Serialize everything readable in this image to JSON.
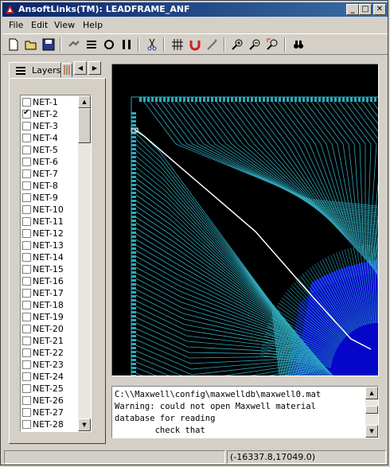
{
  "window": {
    "title": "AnsoftLinks(TM): LEADFRAME_ANF",
    "minimize": "_",
    "maximize": "□",
    "close": "✕"
  },
  "menu": {
    "items": [
      "File",
      "Edit",
      "View",
      "Help"
    ]
  },
  "toolbar": {
    "icons": [
      "new-icon",
      "open-icon",
      "save-icon",
      "line-icon",
      "layers-icon",
      "circle-icon",
      "columns-icon",
      "cut-icon",
      "grid-icon",
      "magnet-icon",
      "wand-icon",
      "zoom-in-icon",
      "zoom-out-icon",
      "zoom-fit-icon",
      "binoculars-icon"
    ]
  },
  "tabs": {
    "active": "Layers",
    "prev": "◀",
    "next": "▶"
  },
  "nets": [
    {
      "label": "NET-1",
      "checked": false
    },
    {
      "label": "NET-2",
      "checked": true
    },
    {
      "label": "NET-3",
      "checked": false
    },
    {
      "label": "NET-4",
      "checked": false
    },
    {
      "label": "NET-5",
      "checked": false
    },
    {
      "label": "NET-6",
      "checked": false
    },
    {
      "label": "NET-7",
      "checked": false
    },
    {
      "label": "NET-8",
      "checked": false
    },
    {
      "label": "NET-9",
      "checked": false
    },
    {
      "label": "NET-10",
      "checked": false
    },
    {
      "label": "NET-11",
      "checked": false
    },
    {
      "label": "NET-12",
      "checked": false
    },
    {
      "label": "NET-13",
      "checked": false
    },
    {
      "label": "NET-14",
      "checked": false
    },
    {
      "label": "NET-15",
      "checked": false
    },
    {
      "label": "NET-16",
      "checked": false
    },
    {
      "label": "NET-17",
      "checked": false
    },
    {
      "label": "NET-18",
      "checked": false
    },
    {
      "label": "NET-19",
      "checked": false
    },
    {
      "label": "NET-20",
      "checked": false
    },
    {
      "label": "NET-21",
      "checked": false
    },
    {
      "label": "NET-22",
      "checked": false
    },
    {
      "label": "NET-23",
      "checked": false
    },
    {
      "label": "NET-24",
      "checked": false
    },
    {
      "label": "NET-25",
      "checked": false
    },
    {
      "label": "NET-26",
      "checked": false
    },
    {
      "label": "NET-27",
      "checked": false
    },
    {
      "label": "NET-28",
      "checked": false
    }
  ],
  "console": {
    "lines": [
      "C:\\\\Maxwell\\config\\maxwelldb\\maxwell0.mat",
      "Warning: could not open Maxwell material",
      "database for reading",
      "        check that"
    ]
  },
  "status": {
    "coords": "(-16337.8,17049.0)"
  },
  "colors": {
    "trace": "#2fa9bc",
    "highlight": "#ffffff",
    "die": "#1010d8",
    "background": "#000000"
  }
}
